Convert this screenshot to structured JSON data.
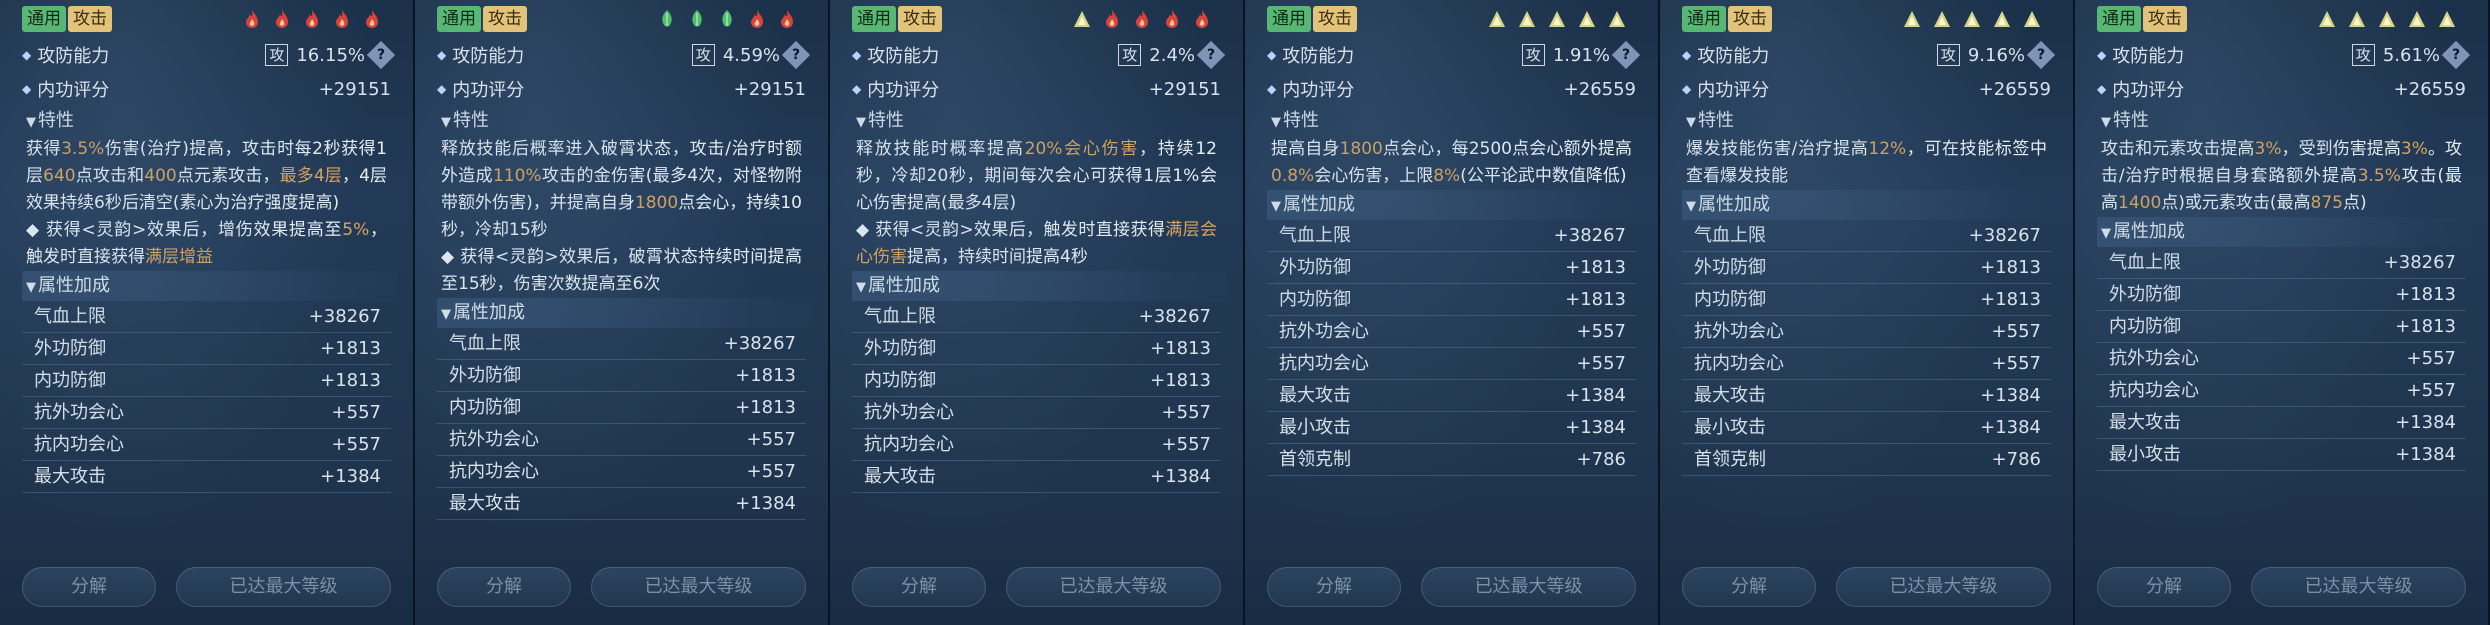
{
  "labels": {
    "tag_general": "通用",
    "tag_attack": "攻击",
    "attack_defense": "攻防能力",
    "attack_box": "攻",
    "help": "?",
    "inner_score": "内功评分",
    "traits": "特性",
    "attr_bonus": "属性加成",
    "decompose": "分解",
    "max_level": "已达最大等级"
  },
  "colors": {
    "fire": "#d8443b",
    "leaf": "#4fbf6e",
    "triangle": "#d8d38a"
  },
  "panels": [
    {
      "slots": [
        "fire-icon",
        "fire-icon",
        "fire-icon",
        "fire-icon",
        "fire-icon"
      ],
      "percent": "16.15%",
      "score": "+29151",
      "desc": [
        [
          {
            "t": "获得"
          },
          {
            "t": "3.5%",
            "h": true
          },
          {
            "t": "伤害(治疗)提高，攻击时每2秒获得1层"
          },
          {
            "t": "640",
            "h": true
          },
          {
            "t": "点攻击和"
          },
          {
            "t": "400",
            "h": true
          },
          {
            "t": "点元素攻击，"
          },
          {
            "t": "最多4层",
            "h": true
          },
          {
            "t": "，4层效果持续6秒后清空(素心为治疗强度提高)"
          }
        ],
        [
          {
            "t": "◆ 获得<灵韵>效果后，增伤效果提高至"
          },
          {
            "t": "5%",
            "h": true
          },
          {
            "t": "，触发时直接获得"
          },
          {
            "t": "满层增益",
            "h": true
          }
        ]
      ],
      "stats": [
        {
          "name": "气血上限",
          "value": "+38267"
        },
        {
          "name": "外功防御",
          "value": "+1813"
        },
        {
          "name": "内功防御",
          "value": "+1813"
        },
        {
          "name": "抗外功会心",
          "value": "+557"
        },
        {
          "name": "抗内功会心",
          "value": "+557"
        },
        {
          "name": "最大攻击",
          "value": "+1384"
        }
      ]
    },
    {
      "slots": [
        "leaf-icon",
        "leaf-icon",
        "leaf-icon",
        "fire-icon",
        "fire-icon"
      ],
      "percent": "4.59%",
      "score": "+29151",
      "desc": [
        [
          {
            "t": "释放技能后概率进入破霄状态，攻击/治疗时额外造成"
          },
          {
            "t": "110%",
            "h": true
          },
          {
            "t": "攻击的金伤害(最多4次，对怪物附带额外伤害)，并提高自身"
          },
          {
            "t": "1800",
            "h": true
          },
          {
            "t": "点会心，持续10秒，冷却15秒"
          }
        ],
        [
          {
            "t": "◆ 获得<灵韵>效果后，破霄状态持续时间提高至15秒，伤害次数提高至6次"
          }
        ]
      ],
      "stats": [
        {
          "name": "气血上限",
          "value": "+38267"
        },
        {
          "name": "外功防御",
          "value": "+1813"
        },
        {
          "name": "内功防御",
          "value": "+1813"
        },
        {
          "name": "抗外功会心",
          "value": "+557"
        },
        {
          "name": "抗内功会心",
          "value": "+557"
        },
        {
          "name": "最大攻击",
          "value": "+1384"
        }
      ]
    },
    {
      "slots": [
        "triangle-icon",
        "fire-icon",
        "fire-icon",
        "fire-icon",
        "fire-icon"
      ],
      "percent": "2.4%",
      "score": "+29151",
      "desc": [
        [
          {
            "t": "释放技能时概率提高"
          },
          {
            "t": "20%会心伤害",
            "h": true
          },
          {
            "t": "，持续12秒，冷却20秒，期间每次会心可获得1层1%会心伤害提高(最多4层)"
          }
        ],
        [
          {
            "t": "◆ 获得<灵韵>效果后，触发时直接获得"
          },
          {
            "t": "满层会心伤害",
            "h": true
          },
          {
            "t": "提高，持续时间提高4秒"
          }
        ]
      ],
      "stats": [
        {
          "name": "气血上限",
          "value": "+38267"
        },
        {
          "name": "外功防御",
          "value": "+1813"
        },
        {
          "name": "内功防御",
          "value": "+1813"
        },
        {
          "name": "抗外功会心",
          "value": "+557"
        },
        {
          "name": "抗内功会心",
          "value": "+557"
        },
        {
          "name": "最大攻击",
          "value": "+1384"
        }
      ]
    },
    {
      "slots": [
        "triangle-icon",
        "triangle-icon",
        "triangle-icon",
        "triangle-icon",
        "triangle-icon"
      ],
      "percent": "1.91%",
      "score": "+26559",
      "desc": [
        [
          {
            "t": "提高自身"
          },
          {
            "t": "1800",
            "h": true
          },
          {
            "t": "点会心，每2500点会心额外提高"
          },
          {
            "t": "0.8%",
            "h": true
          },
          {
            "t": "会心伤害，上限"
          },
          {
            "t": "8%",
            "h": true
          },
          {
            "t": "(公平论武中数值降低)"
          }
        ]
      ],
      "stats": [
        {
          "name": "气血上限",
          "value": "+38267"
        },
        {
          "name": "外功防御",
          "value": "+1813"
        },
        {
          "name": "内功防御",
          "value": "+1813"
        },
        {
          "name": "抗外功会心",
          "value": "+557"
        },
        {
          "name": "抗内功会心",
          "value": "+557"
        },
        {
          "name": "最大攻击",
          "value": "+1384"
        },
        {
          "name": "最小攻击",
          "value": "+1384"
        },
        {
          "name": "首领克制",
          "value": "+786"
        }
      ]
    },
    {
      "slots": [
        "triangle-icon",
        "triangle-icon",
        "triangle-icon",
        "triangle-icon",
        "triangle-icon"
      ],
      "percent": "9.16%",
      "score": "+26559",
      "desc": [
        [
          {
            "t": "爆发技能伤害/治疗提高"
          },
          {
            "t": "12%",
            "h": true
          },
          {
            "t": "，可在技能标签中查看爆发技能"
          }
        ]
      ],
      "stats": [
        {
          "name": "气血上限",
          "value": "+38267"
        },
        {
          "name": "外功防御",
          "value": "+1813"
        },
        {
          "name": "内功防御",
          "value": "+1813"
        },
        {
          "name": "抗外功会心",
          "value": "+557"
        },
        {
          "name": "抗内功会心",
          "value": "+557"
        },
        {
          "name": "最大攻击",
          "value": "+1384"
        },
        {
          "name": "最小攻击",
          "value": "+1384"
        },
        {
          "name": "首领克制",
          "value": "+786"
        }
      ]
    },
    {
      "slots": [
        "triangle-icon",
        "triangle-icon",
        "triangle-icon",
        "triangle-icon",
        "triangle-icon"
      ],
      "percent": "5.61%",
      "score": "+26559",
      "desc": [
        [
          {
            "t": "攻击和元素攻击提高"
          },
          {
            "t": "3%",
            "h": true
          },
          {
            "t": "，受到伤害提高"
          },
          {
            "t": "3%",
            "h": true
          },
          {
            "t": "。攻击/治疗时根据自身套路额外提高"
          },
          {
            "t": "3.5%",
            "h": true
          },
          {
            "t": "攻击(最高"
          },
          {
            "t": "1400",
            "h": true
          },
          {
            "t": "点)或元素攻击(最高"
          },
          {
            "t": "875",
            "h": true
          },
          {
            "t": "点)"
          }
        ]
      ],
      "stats": [
        {
          "name": "气血上限",
          "value": "+38267"
        },
        {
          "name": "外功防御",
          "value": "+1813"
        },
        {
          "name": "内功防御",
          "value": "+1813"
        },
        {
          "name": "抗外功会心",
          "value": "+557"
        },
        {
          "name": "抗内功会心",
          "value": "+557"
        },
        {
          "name": "最大攻击",
          "value": "+1384"
        },
        {
          "name": "最小攻击",
          "value": "+1384"
        }
      ]
    }
  ]
}
